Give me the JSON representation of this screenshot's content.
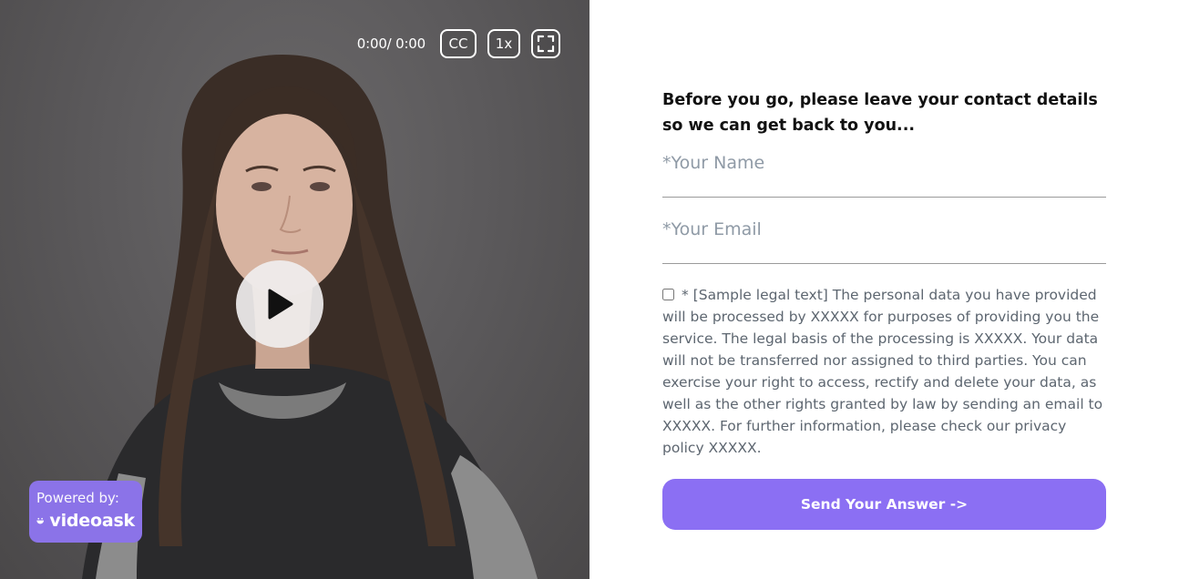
{
  "video": {
    "time": "0:00/ 0:00",
    "cc_label": "CC",
    "rate_label": "1x",
    "fullscreen_icon": "fullscreen-icon",
    "play_icon": "play-icon"
  },
  "branding": {
    "powered_by": "Powered by:",
    "brand_name": "videoask",
    "brand_icon": "smiley-icon",
    "accent_color": "#8b73e8"
  },
  "form": {
    "heading": "Before you go, please leave your contact details so we can get back to you...",
    "name_placeholder": "*Your Name",
    "email_placeholder": "*Your Email",
    "legal_text": "* [Sample legal text] The personal data you have provided will be processed by XXXXX for purposes of providing you the service. The legal basis of the processing is XXXXX. Your data will not be transferred nor assigned to third parties. You can exercise your right to access, rectify and delete your data, as well as the other rights granted by law by sending an email to XXXXX. For further information, please check our privacy policy XXXXX.",
    "legal_checked": false,
    "submit_label": "Send Your Answer ->",
    "button_color": "#8b6ff3"
  }
}
